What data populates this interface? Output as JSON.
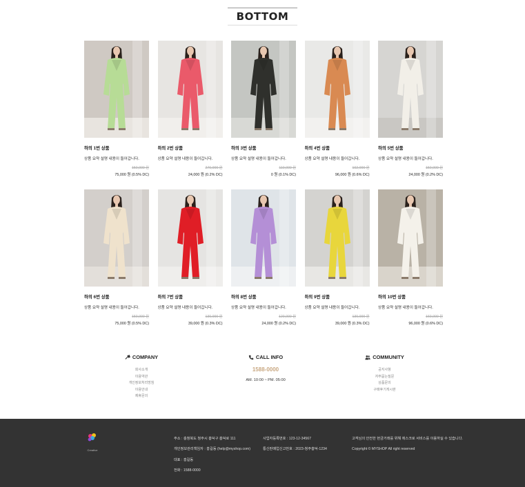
{
  "section_title": "BOTTOM",
  "products": [
    {
      "name": "하의 1번 상품",
      "desc": "상품 요약 설명 내용이 들어갑니다.",
      "original_price": "150,000 원",
      "sale_price": "75,000 원 (0.5% DC)",
      "bg": "#cfc9c3",
      "outfit": "#b7dc96",
      "floor": "#e8e4df"
    },
    {
      "name": "하의 2번 상품",
      "desc": "상품 요약 설명 내용이 들어갑니다.",
      "original_price": "270,000 원",
      "sale_price": "24,000 원 (0.2% DC)",
      "bg": "#e7e5e2",
      "outfit": "#ea5a6a",
      "floor": "#f1efec"
    },
    {
      "name": "하의 3번 상품",
      "desc": "상품 요약 설명 내용이 들어갑니다.",
      "original_price": "110,000 원",
      "sale_price": "0 원 (0.1% DC)",
      "bg": "#c4c6c2",
      "outfit": "#2f302c",
      "floor": "#d8d9d5"
    },
    {
      "name": "하의 4번 상품",
      "desc": "상품 요약 설명 내용이 들어갑니다.",
      "original_price": "102,000 원",
      "sale_price": "96,000 원 (0.6% DC)",
      "bg": "#e9e9e7",
      "outfit": "#d98a52",
      "floor": "#f2f1ef"
    },
    {
      "name": "하의 5번 상품",
      "desc": "상품 요약 설명 내용이 들어갑니다.",
      "original_price": "150,000 원",
      "sale_price": "24,000 원 (0.2% DC)",
      "bg": "#d6d5d2",
      "outfit": "#f2efe8",
      "floor": "#c9c7c3"
    },
    {
      "name": "하의 6번 상품",
      "desc": "상품 요약 설명 내용이 들어갑니다.",
      "original_price": "150,000 원",
      "sale_price": "75,000 원 (0.5% DC)",
      "bg": "#d3cfcb",
      "outfit": "#efe2cc",
      "floor": "#e3dfda"
    },
    {
      "name": "하의 7번 상품",
      "desc": "상품 요약 설명 내용이 들어갑니다.",
      "original_price": "130,000 원",
      "sale_price": "39,000 원 (0.3% DC)",
      "bg": "#e5e4e2",
      "outfit": "#e01e26",
      "floor": "#efeeec"
    },
    {
      "name": "하의 8번 상품",
      "desc": "상품 요약 설명 내용이 들어갑니다.",
      "original_price": "120,000 원",
      "sale_price": "24,000 원 (0.2% DC)",
      "bg": "#dfe4e8",
      "outfit": "#b48fd6",
      "floor": "#eef0f2"
    },
    {
      "name": "하의 9번 상품",
      "desc": "상품 요약 설명 내용이 들어갑니다.",
      "original_price": "130,000 원",
      "sale_price": "39,000 원 (0.3% DC)",
      "bg": "#d4d3d0",
      "outfit": "#e8d63c",
      "floor": "#e8e7e4"
    },
    {
      "name": "하의 10번 상품",
      "desc": "상품 요약 설명 내용이 들어갑니다.",
      "original_price": "160,000 원",
      "sale_price": "96,000 원 (0.6% DC)",
      "bg": "#b9b2a6",
      "outfit": "#f4f1ea",
      "floor": "#d9d4cb"
    }
  ],
  "footer_info": {
    "company": {
      "title": "COMPANY",
      "links": [
        "회사소개",
        "이용약관",
        "개인정보처리방침",
        "이용안내",
        "제휴문의"
      ]
    },
    "call": {
      "title": "CALL INFO",
      "number": "1588-0000",
      "hours": "AM. 10:00 ~ PM. 05:00"
    },
    "community": {
      "title": "COMMUNITY",
      "links": [
        "공지사항",
        "자주묻는질문",
        "상품문의",
        "구매후기게시판"
      ]
    }
  },
  "footer": {
    "brand": "Creative",
    "col1": [
      "주소 : 충청북도 청주시 흥덕구 흥덕로 111",
      "개인정보관리책임자 : 홍길동 (help@myshop.com)",
      "대표 : 홍길동",
      "전화 : 1588-0000"
    ],
    "col2": [
      "사업자등록번호 : 123-12-34567",
      "통신판매업신고번호 : 2023-청주흥덕-1234"
    ],
    "col3": [
      "고객님의 안전한 현금거래를 위해 에스크로 서비스를 이용하실 수 있습니다.",
      "Copyright © MYSHOP All right reserved"
    ]
  },
  "colors": {
    "footer_bg": "#333333",
    "call_accent": "#c9a882"
  }
}
